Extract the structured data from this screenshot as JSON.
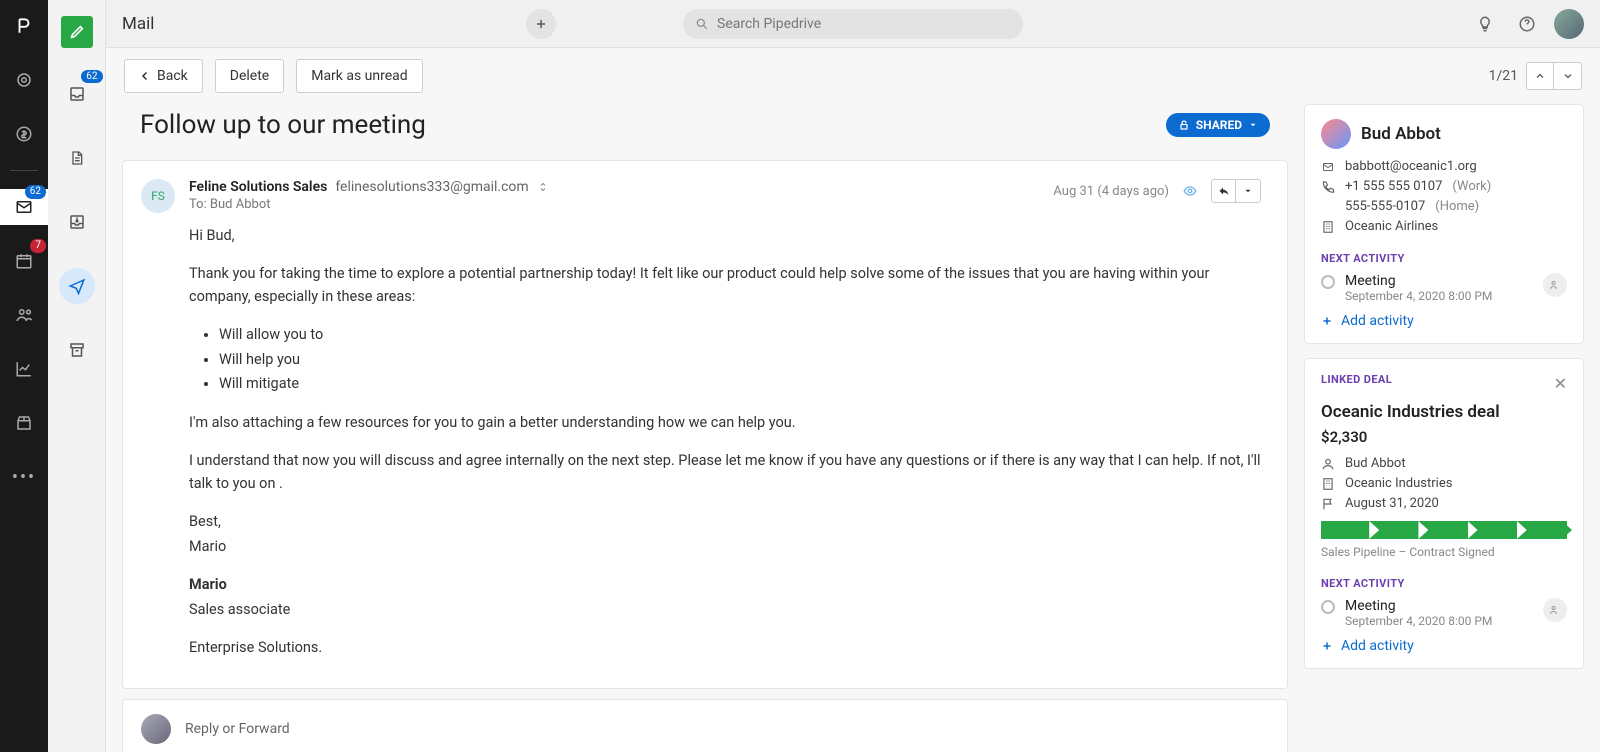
{
  "topbar": {
    "app_title": "Mail",
    "search_placeholder": "Search Pipedrive"
  },
  "rail": {
    "mail_badge": "62",
    "calendar_badge": "7"
  },
  "subnav": {
    "inbox_badge": "62"
  },
  "toolbar": {
    "back": "Back",
    "delete": "Delete",
    "mark_unread": "Mark as unread",
    "counter": "1/21"
  },
  "mail": {
    "subject": "Follow up to our meeting",
    "shared_label": "SHARED",
    "sender": {
      "initials": "FS",
      "name": "Feline Solutions Sales",
      "email": "felinesolutions333@gmail.com",
      "to": "To: Bud Abbot",
      "date": "Aug 31 (4 days ago)"
    },
    "body": {
      "greeting": "Hi Bud,",
      "p1": "Thank you for taking the time to explore a potential partnership today! It felt like our product could help solve some of the issues that you are having within your company, especially in these areas:",
      "bullets": [
        "Will allow you to",
        "Will help you",
        "Will mitigate"
      ],
      "p2": "I'm also attaching a few resources for you to gain a better understanding how we can help you.",
      "p3": "I understand that now you will discuss and agree internally on the next step. Please let me know if you have any questions or if there is any way that I can help. If not, I'll talk to you on .",
      "signoff1": "Best,",
      "signoff2": "Mario",
      "sig_name": "Mario",
      "sig_role": "Sales associate",
      "sig_org": "Enterprise Solutions."
    },
    "reply_placeholder": "Reply or Forward"
  },
  "contact": {
    "name": "Bud Abbot",
    "email": "babbott@oceanic1.org",
    "phone1": "+1 555 555 0107",
    "phone1_label": "(Work)",
    "phone2": "555-555-0107",
    "phone2_label": "(Home)",
    "org": "Oceanic Airlines",
    "next_activity_header": "NEXT ACTIVITY",
    "activity": {
      "title": "Meeting",
      "when": "September 4, 2020 8:00 PM"
    },
    "add_activity": "Add activity"
  },
  "deal": {
    "header": "LINKED DEAL",
    "title": "Oceanic Industries deal",
    "value": "$2,330",
    "person": "Bud Abbot",
    "org": "Oceanic Industries",
    "date": "August 31, 2020",
    "pipeline_label": "Sales Pipeline – Contract Signed",
    "next_activity_header": "NEXT ACTIVITY",
    "activity": {
      "title": "Meeting",
      "when": "September 4, 2020 8:00 PM"
    },
    "add_activity": "Add activity"
  }
}
